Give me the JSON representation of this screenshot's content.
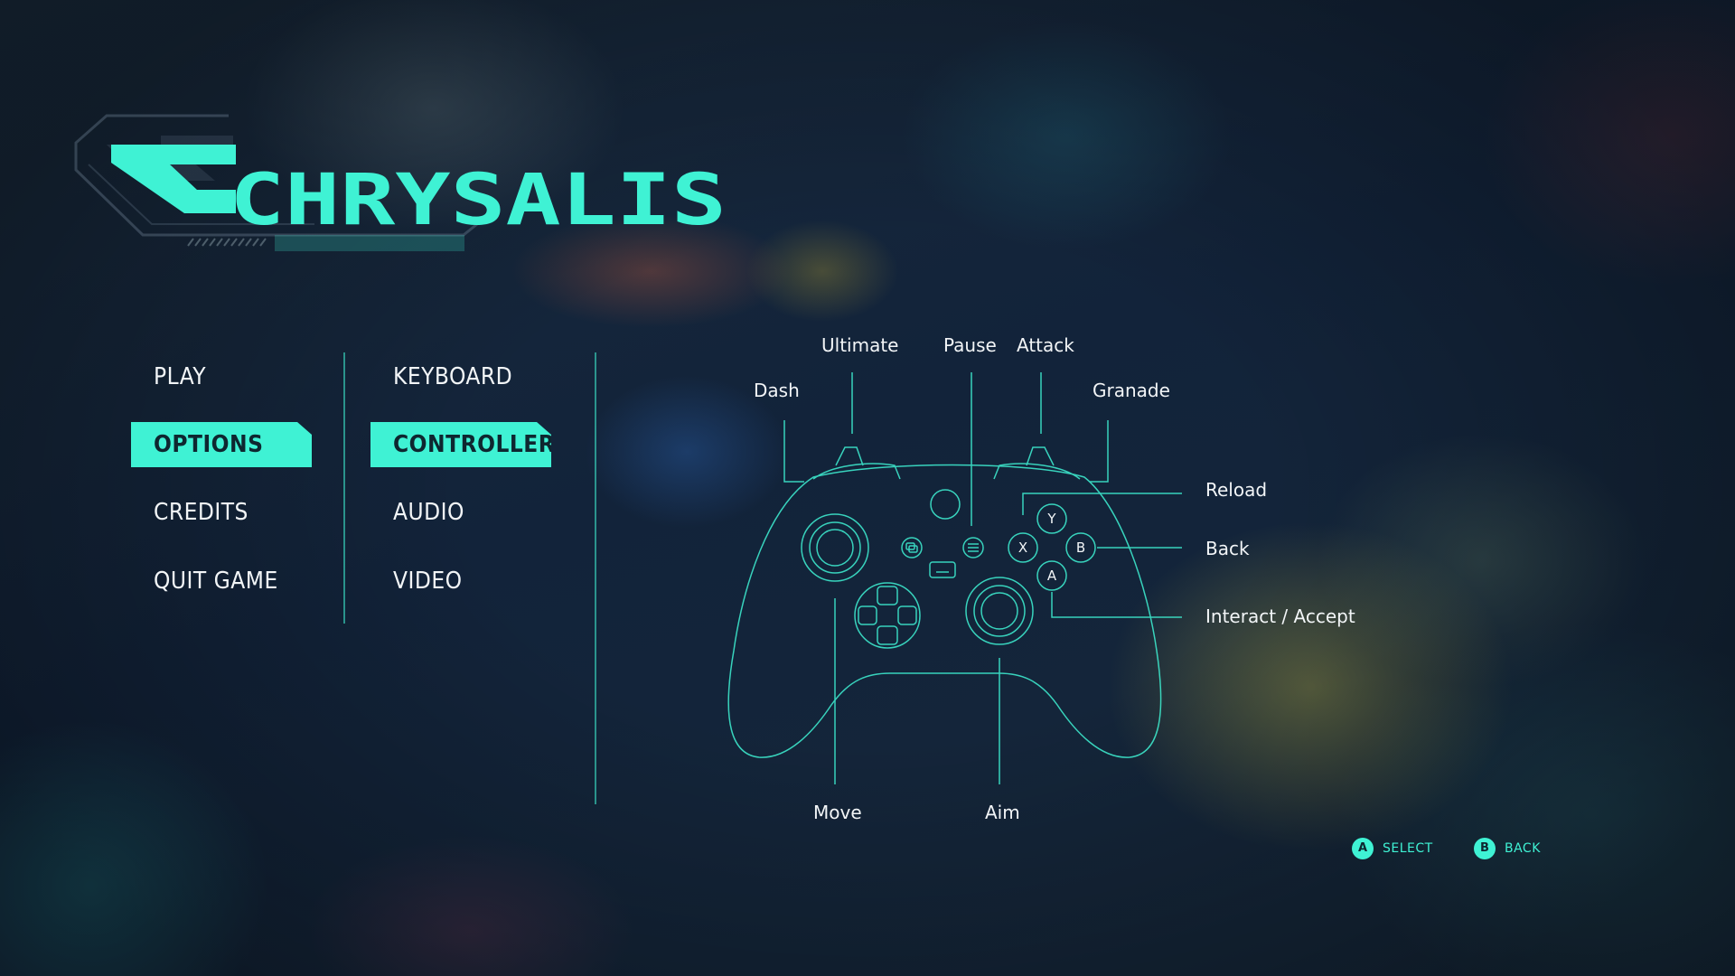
{
  "logo": {
    "text": "CHRYSALIS"
  },
  "main_menu": [
    {
      "label": "PLAY",
      "active": false
    },
    {
      "label": "OPTIONS",
      "active": true
    },
    {
      "label": "CREDITS",
      "active": false
    },
    {
      "label": "QUIT GAME",
      "active": false
    }
  ],
  "options_menu": [
    {
      "label": "KEYBOARD",
      "active": false
    },
    {
      "label": "CONTROLLER",
      "active": true
    },
    {
      "label": "AUDIO",
      "active": false
    },
    {
      "label": "VIDEO",
      "active": false
    }
  ],
  "controller": {
    "labels": {
      "ultimate": "Ultimate",
      "pause": "Pause",
      "attack": "Attack",
      "dash": "Dash",
      "granade": "Granade",
      "reload": "Reload",
      "back": "Back",
      "interact": "Interact / Accept",
      "move": "Move",
      "aim": "Aim"
    },
    "face_buttons": {
      "y": "Y",
      "x": "X",
      "b": "B",
      "a": "A"
    }
  },
  "hints": [
    {
      "button": "A",
      "label": "SELECT"
    },
    {
      "button": "B",
      "label": "BACK"
    }
  ],
  "colors": {
    "accent": "#3ff2d4",
    "text": "#f2f5f7",
    "background": "#14243a"
  }
}
